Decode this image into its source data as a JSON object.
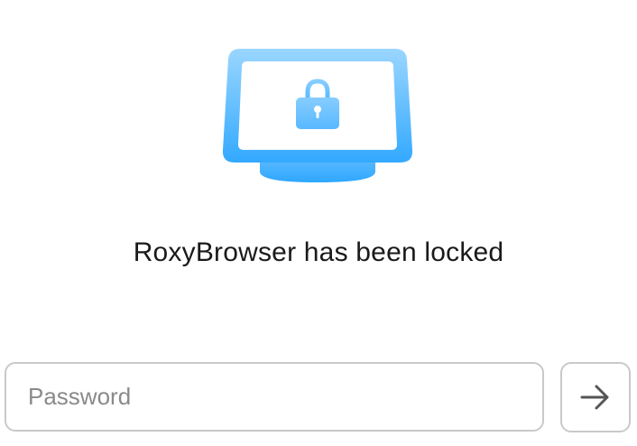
{
  "lock_screen": {
    "title": "RoxyBrowser has been locked",
    "illustration_icon": "monitor-lock-icon",
    "accent_light": "#a8dcff",
    "accent_dark": "#2fa8ff"
  },
  "password": {
    "placeholder": "Password",
    "value": ""
  },
  "submit": {
    "icon": "arrow-right-icon"
  }
}
